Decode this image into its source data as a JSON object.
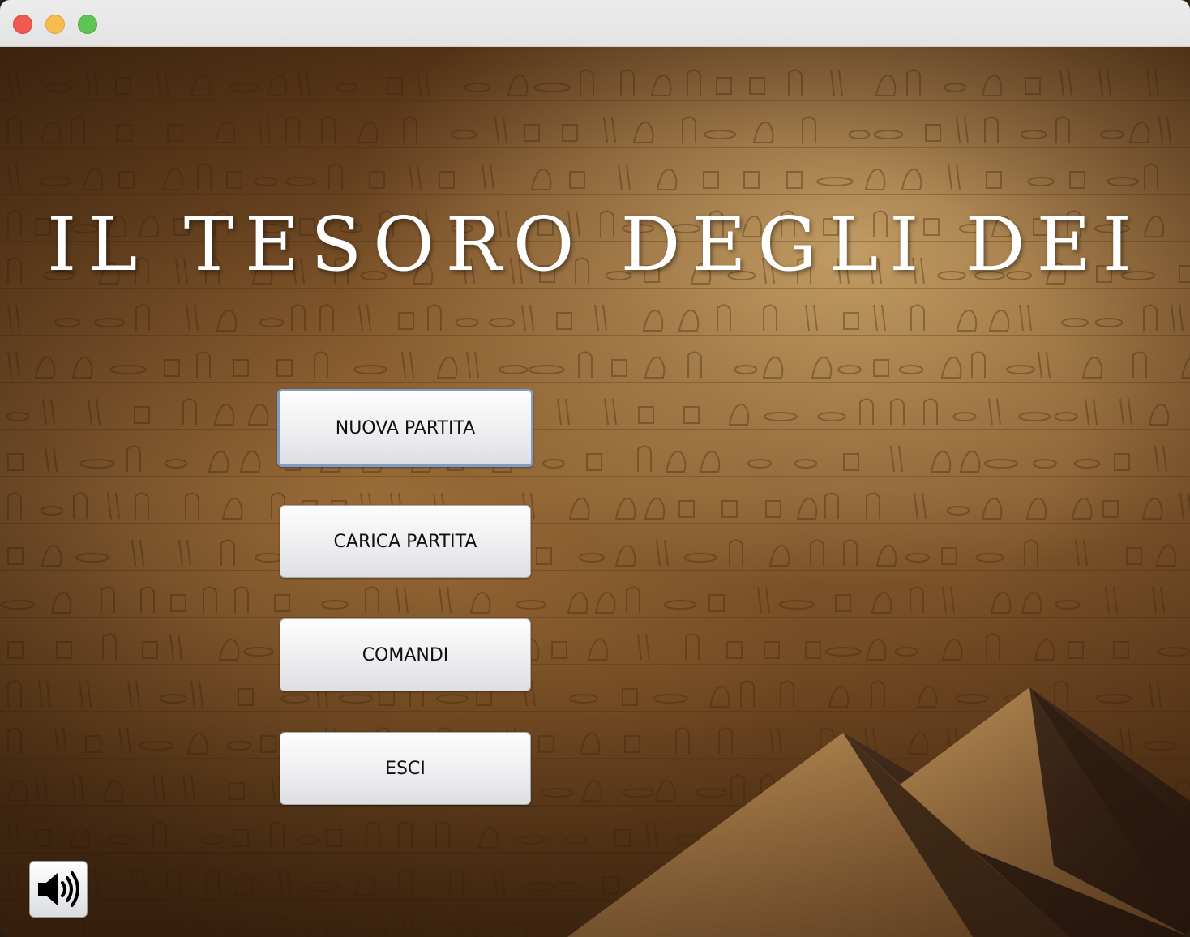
{
  "window": {
    "controls": [
      "close",
      "minimize",
      "maximize"
    ]
  },
  "game": {
    "title": "IL TESORO DEGLI DEI"
  },
  "menu": {
    "new_game_label": "NUOVA PARTITA",
    "load_game_label": "CARICA PARTITA",
    "commands_label": "COMANDI",
    "exit_label": "ESCI"
  },
  "sound": {
    "icon": "speaker-volume-icon"
  },
  "colors": {
    "title_text": "#ffffff",
    "button_focus_ring": "#7d9cc8",
    "sandstone": "#a7773f"
  }
}
